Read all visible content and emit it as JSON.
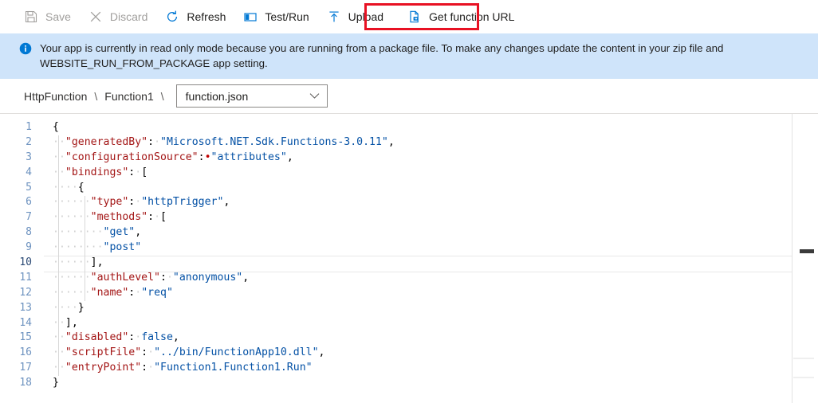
{
  "toolbar": {
    "items": [
      {
        "label": "Save",
        "icon": "save-icon",
        "enabled": false,
        "highlighted": false
      },
      {
        "label": "Discard",
        "icon": "discard-icon",
        "enabled": false,
        "highlighted": false
      },
      {
        "label": "Refresh",
        "icon": "refresh-icon",
        "enabled": true,
        "highlighted": false
      },
      {
        "label": "Test/Run",
        "icon": "test-run-icon",
        "enabled": true,
        "highlighted": false
      },
      {
        "label": "Upload",
        "icon": "upload-icon",
        "enabled": true,
        "highlighted": false
      },
      {
        "label": "Get function URL",
        "icon": "get-url-icon",
        "enabled": true,
        "highlighted": true
      }
    ],
    "highlight_color": "#e81123"
  },
  "banner": {
    "icon": "info-icon",
    "text": "Your app is currently in read only mode because you are running from a package file. To make any changes update the content in your zip file and WEBSITE_RUN_FROM_PACKAGE app setting.",
    "background_color": "#cfe4fa",
    "icon_color": "#0078d4"
  },
  "breadcrumb": {
    "app_name": "HttpFunction",
    "function_name": "Function1",
    "separator": "\\",
    "file_select": {
      "value": "function.json",
      "chevron": "chevron-down-icon"
    }
  },
  "editor": {
    "active_line": 10,
    "total_lines": 18,
    "lines": [
      {
        "n": 1,
        "tokens": [
          {
            "t": "pun",
            "v": "{"
          }
        ]
      },
      {
        "n": 2,
        "tokens": [
          {
            "t": "ws",
            "v": "··"
          },
          {
            "t": "key",
            "v": "\"generatedBy\""
          },
          {
            "t": "pun",
            "v": ":"
          },
          {
            "t": "ws",
            "v": "·"
          },
          {
            "t": "str",
            "v": "\"Microsoft.NET.Sdk.Functions-3.0.11\""
          },
          {
            "t": "pun",
            "v": ","
          }
        ]
      },
      {
        "n": 3,
        "tokens": [
          {
            "t": "ws",
            "v": "··"
          },
          {
            "t": "key",
            "v": "\"configurationSource\""
          },
          {
            "t": "pun",
            "v": ":"
          },
          {
            "t": "wsdot",
            "v": "•"
          },
          {
            "t": "str",
            "v": "\"attributes\""
          },
          {
            "t": "pun",
            "v": ","
          }
        ]
      },
      {
        "n": 4,
        "tokens": [
          {
            "t": "ws",
            "v": "··"
          },
          {
            "t": "key",
            "v": "\"bindings\""
          },
          {
            "t": "pun",
            "v": ":"
          },
          {
            "t": "ws",
            "v": "·"
          },
          {
            "t": "pun",
            "v": "["
          }
        ]
      },
      {
        "n": 5,
        "tokens": [
          {
            "t": "ws",
            "v": "····"
          },
          {
            "t": "pun",
            "v": "{"
          }
        ]
      },
      {
        "n": 6,
        "tokens": [
          {
            "t": "ws",
            "v": "······"
          },
          {
            "t": "key",
            "v": "\"type\""
          },
          {
            "t": "pun",
            "v": ":"
          },
          {
            "t": "ws",
            "v": "·"
          },
          {
            "t": "str",
            "v": "\"httpTrigger\""
          },
          {
            "t": "pun",
            "v": ","
          }
        ]
      },
      {
        "n": 7,
        "tokens": [
          {
            "t": "ws",
            "v": "······"
          },
          {
            "t": "key",
            "v": "\"methods\""
          },
          {
            "t": "pun",
            "v": ":"
          },
          {
            "t": "ws",
            "v": "·"
          },
          {
            "t": "pun",
            "v": "["
          }
        ]
      },
      {
        "n": 8,
        "tokens": [
          {
            "t": "ws",
            "v": "········"
          },
          {
            "t": "str",
            "v": "\"get\""
          },
          {
            "t": "pun",
            "v": ","
          }
        ]
      },
      {
        "n": 9,
        "tokens": [
          {
            "t": "ws",
            "v": "········"
          },
          {
            "t": "str",
            "v": "\"post\""
          }
        ]
      },
      {
        "n": 10,
        "tokens": [
          {
            "t": "ws",
            "v": "······"
          },
          {
            "t": "pun",
            "v": "],"
          }
        ]
      },
      {
        "n": 11,
        "tokens": [
          {
            "t": "ws",
            "v": "······"
          },
          {
            "t": "key",
            "v": "\"authLevel\""
          },
          {
            "t": "pun",
            "v": ":"
          },
          {
            "t": "ws",
            "v": "·"
          },
          {
            "t": "str",
            "v": "\"anonymous\""
          },
          {
            "t": "pun",
            "v": ","
          }
        ]
      },
      {
        "n": 12,
        "tokens": [
          {
            "t": "ws",
            "v": "······"
          },
          {
            "t": "key",
            "v": "\"name\""
          },
          {
            "t": "pun",
            "v": ":"
          },
          {
            "t": "ws",
            "v": "·"
          },
          {
            "t": "str",
            "v": "\"req\""
          }
        ]
      },
      {
        "n": 13,
        "tokens": [
          {
            "t": "ws",
            "v": "····"
          },
          {
            "t": "pun",
            "v": "}"
          }
        ]
      },
      {
        "n": 14,
        "tokens": [
          {
            "t": "ws",
            "v": "··"
          },
          {
            "t": "pun",
            "v": "],"
          }
        ]
      },
      {
        "n": 15,
        "tokens": [
          {
            "t": "ws",
            "v": "··"
          },
          {
            "t": "key",
            "v": "\"disabled\""
          },
          {
            "t": "pun",
            "v": ":"
          },
          {
            "t": "ws",
            "v": "·"
          },
          {
            "t": "bool",
            "v": "false"
          },
          {
            "t": "pun",
            "v": ","
          }
        ]
      },
      {
        "n": 16,
        "tokens": [
          {
            "t": "ws",
            "v": "··"
          },
          {
            "t": "key",
            "v": "\"scriptFile\""
          },
          {
            "t": "pun",
            "v": ":"
          },
          {
            "t": "ws",
            "v": "·"
          },
          {
            "t": "str",
            "v": "\"../bin/FunctionApp10.dll\""
          },
          {
            "t": "pun",
            "v": ","
          }
        ]
      },
      {
        "n": 17,
        "tokens": [
          {
            "t": "ws",
            "v": "··"
          },
          {
            "t": "key",
            "v": "\"entryPoint\""
          },
          {
            "t": "pun",
            "v": ":"
          },
          {
            "t": "ws",
            "v": "·"
          },
          {
            "t": "str",
            "v": "\"Function1.Function1.Run\""
          }
        ]
      },
      {
        "n": 18,
        "tokens": [
          {
            "t": "pun",
            "v": "}"
          }
        ]
      }
    ],
    "colors": {
      "key": "#a31515",
      "string": "#0451a5",
      "punctuation": "#000000",
      "line_number": "#6e93c0",
      "whitespace_dot": "#d0d0d0"
    }
  }
}
